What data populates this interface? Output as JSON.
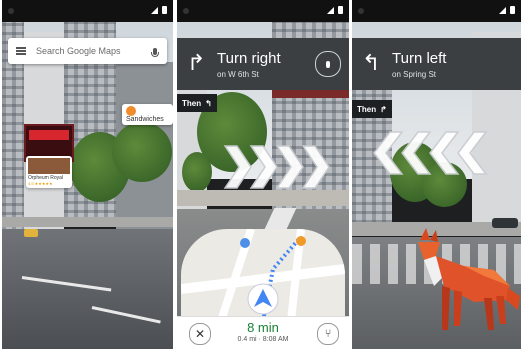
{
  "phones": [
    {
      "search": {
        "placeholder": "Search Google Maps"
      },
      "labels": {
        "sandwiches": "Sandwiches",
        "place_name": "Orpheum Royal",
        "place_rating": "4.5 ★★★★★"
      }
    },
    {
      "nav": {
        "arrow": "↱",
        "instruction": "Turn right",
        "street": "on W 6th St"
      },
      "then": {
        "label": "Then",
        "arrow": "↰"
      },
      "bottom": {
        "close": "✕",
        "eta": "8 min",
        "details": "0.4 mi · 8:08 AM",
        "route": "⑂"
      }
    },
    {
      "nav": {
        "arrow": "↰",
        "instruction": "Turn left",
        "street": "on Spring St"
      },
      "then": {
        "label": "Then",
        "arrow": "↱"
      }
    }
  ],
  "colors": {
    "nav_bar": "#3b3f42",
    "eta_green": "#188038",
    "route_blue": "#4285f4",
    "fox_orange": "#e0522a"
  }
}
